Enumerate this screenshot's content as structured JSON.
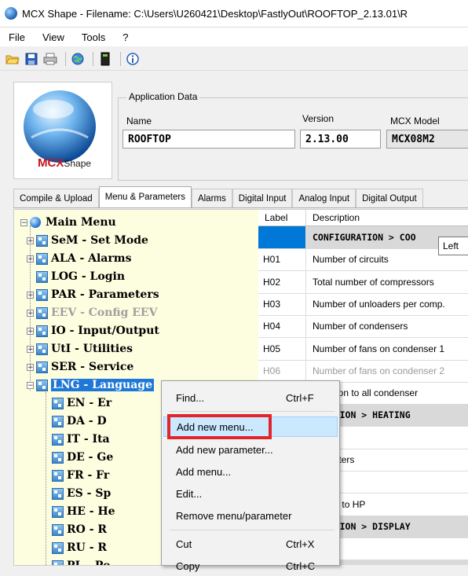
{
  "window": {
    "title": "MCX Shape  -  Filename: C:\\Users\\U260421\\Desktop\\FastlyOut\\ROOFTOP_2.13.01\\R"
  },
  "menubar": [
    "File",
    "View",
    "Tools",
    "?"
  ],
  "toolbar": [
    "open-folder-icon",
    "save-icon",
    "print-icon",
    "globe-icon",
    "device-icon",
    "info-icon"
  ],
  "logo": {
    "text": "MCXShape"
  },
  "app_data": {
    "legend": "Application Data",
    "name_label": "Name",
    "name_value": "ROOFTOP",
    "version_label": "Version",
    "version_value": "2.13.00",
    "model_label": "MCX Model",
    "model_value": "MCX08M2"
  },
  "tabs": [
    "Compile & Upload",
    "Menu & Parameters",
    "Alarms",
    "Digital Input",
    "Analog Input",
    "Digital Output"
  ],
  "active_tab": "Menu & Parameters",
  "tree": {
    "root": "Main Menu",
    "items": [
      "SeM - Set Mode",
      "ALA - Alarms",
      "LOG - Login",
      "PAR - Parameters",
      "EEV - Config EEV",
      "IO - Input/Output",
      "UtI - Utilities",
      "SER - Service",
      "LNG - Language"
    ],
    "sub_items": [
      "EN - Er",
      "DA - D",
      "IT - Ita",
      "DE - Ge",
      "FR - Fr",
      "ES - Sp",
      "HE - He",
      "RO - R",
      "RU - R",
      "PL - Po"
    ]
  },
  "grid": {
    "headers": [
      "Label",
      "Description"
    ],
    "rows": [
      {
        "label": "",
        "desc": "CONFIGURATION > COO"
      },
      {
        "label": "H01",
        "desc": "Number of circuits"
      },
      {
        "label": "H02",
        "desc": "Total number of compressors"
      },
      {
        "label": "H03",
        "desc": "Number of unloaders per comp."
      },
      {
        "label": "H04",
        "desc": "Number of condensers"
      },
      {
        "label": "H05",
        "desc": "Number of fans on condenser 1"
      },
      {
        "label": "H06",
        "desc": "Number of fans on condenser 2"
      },
      {
        "label": "",
        "desc": "common to all condenser"
      },
      {
        "label": "",
        "desc": "GURATION > HEATING"
      },
      {
        "label": "",
        "desc": "type"
      },
      {
        "label": "",
        "desc": "of heaters"
      },
      {
        "label": "",
        "desc": "n time"
      },
      {
        "label": "",
        "desc": "upport to HP"
      },
      {
        "label": "",
        "desc": "GURATION > DISPLAY"
      },
      {
        "label": "",
        "desc": "Icon"
      },
      {
        "label": "",
        "desc": "REGULATION > GENER"
      }
    ],
    "tooltip": "Left"
  },
  "context_menu": {
    "items": [
      {
        "label": "Find...",
        "shortcut": "Ctrl+F"
      },
      {
        "label": "Add new menu...",
        "shortcut": ""
      },
      {
        "label": "Add new parameter...",
        "shortcut": ""
      },
      {
        "label": "Add menu...",
        "shortcut": ""
      },
      {
        "label": "Edit...",
        "shortcut": ""
      },
      {
        "label": "Remove menu/parameter",
        "shortcut": ""
      },
      {
        "label": "Cut",
        "shortcut": "Ctrl+X"
      },
      {
        "label": "Copy",
        "shortcut": "Ctrl+C"
      }
    ]
  },
  "colors": {
    "selection": "#1f78d6",
    "tree_background": "#fdfde0",
    "highlight_box": "#e0262a",
    "menu_hover": "#cce8ff"
  }
}
